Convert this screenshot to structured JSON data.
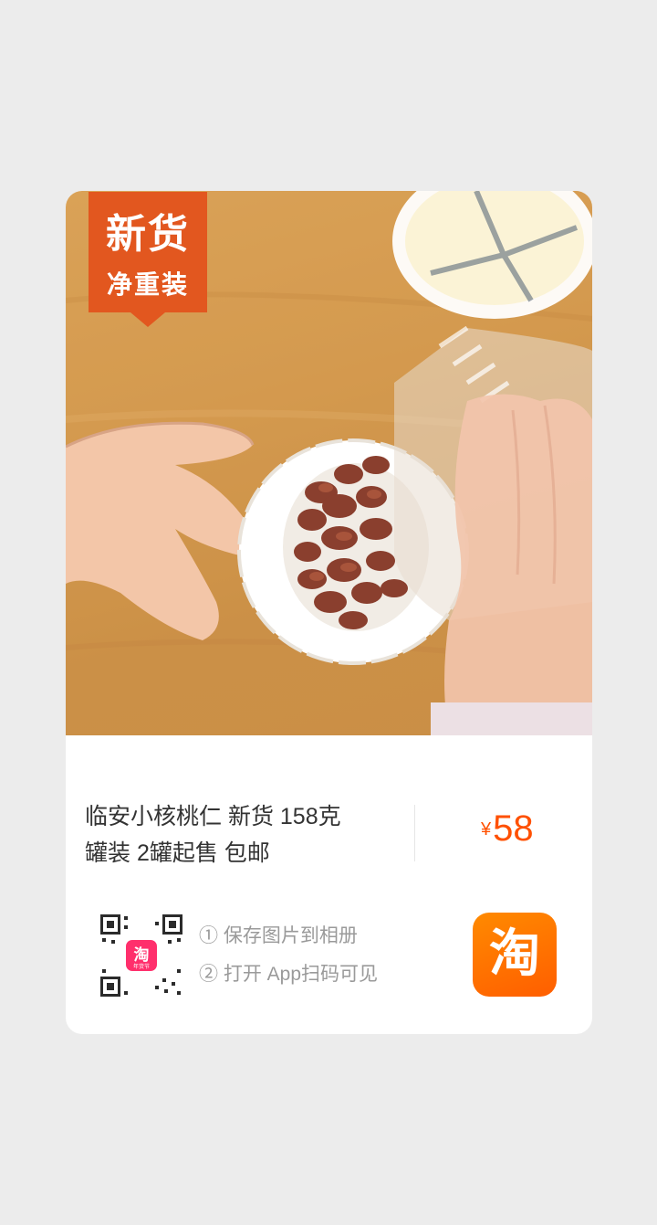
{
  "badge": {
    "line1": "新货",
    "line2": "净重装"
  },
  "product": {
    "title_line1": "临安小核桃仁 新货 158克",
    "title_line2": "罐装 2罐起售 包邮",
    "currency_symbol": "¥",
    "price": "58"
  },
  "steps": {
    "step1": "① 保存图片到相册",
    "step2": "② 打开 App扫码可见"
  },
  "qr_logo_text": "淘",
  "qr_logo_subtext": "年货节",
  "app_logo": {
    "glyph": "淘",
    "icon": "taobao-logo-icon"
  },
  "colors": {
    "accent": "#ff5000",
    "badge": "#e2571f",
    "background": "#ececec"
  }
}
